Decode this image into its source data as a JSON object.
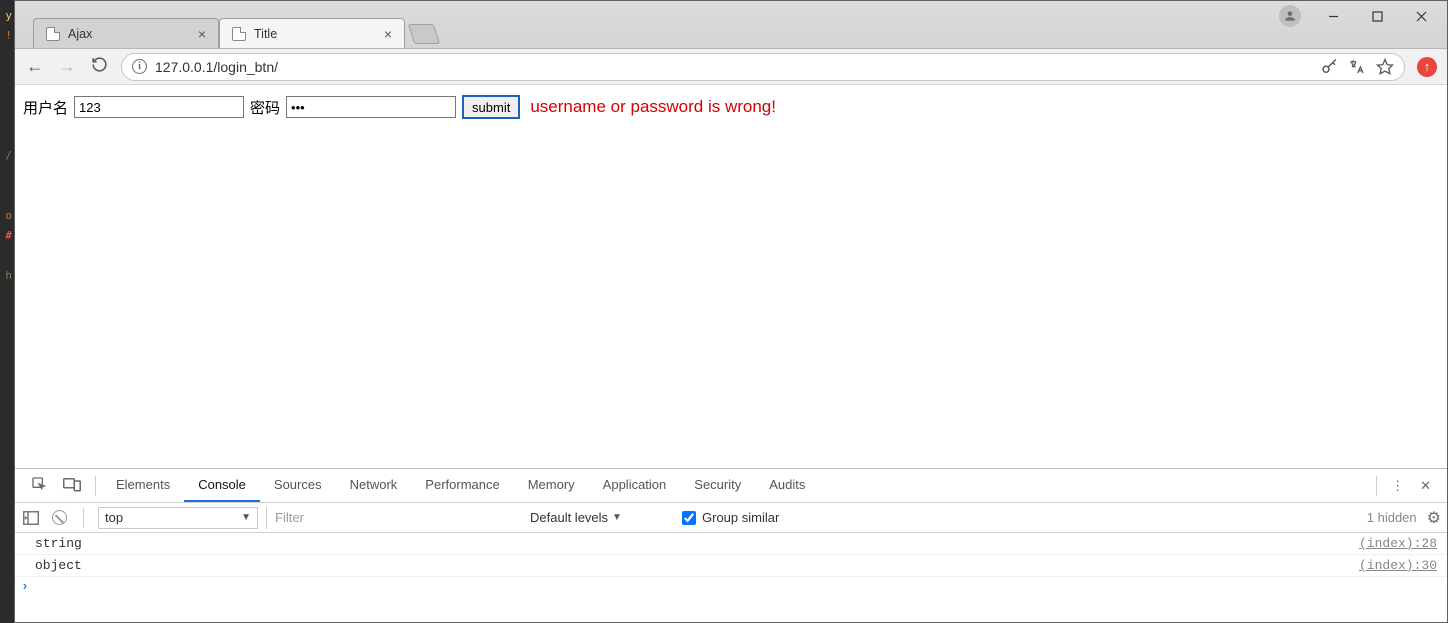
{
  "editor_gutter": [
    "y",
    "!",
    "",
    "",
    "",
    "",
    "",
    "/",
    "",
    "",
    "o",
    "#",
    "",
    "h"
  ],
  "editor_gutter_colors": [
    "g-y",
    "g-o",
    "",
    "",
    "",
    "",
    "",
    "g-s",
    "",
    "",
    "g-o",
    "g-r",
    "",
    "g-s"
  ],
  "window": {
    "tabs": [
      {
        "title": "Ajax",
        "active": false
      },
      {
        "title": "Title",
        "active": true
      }
    ]
  },
  "addrbar": {
    "url": "127.0.0.1/login_btn/"
  },
  "page": {
    "username_label": "用户名",
    "username_value": "123",
    "password_label": "密码",
    "password_value": "•••",
    "submit_label": "submit",
    "error_message": "username or password is wrong!"
  },
  "devtools": {
    "tabs": [
      "Elements",
      "Console",
      "Sources",
      "Network",
      "Performance",
      "Memory",
      "Application",
      "Security",
      "Audits"
    ],
    "tabs_active_index": 1,
    "context_dropdown": "top",
    "filter_placeholder": "Filter",
    "levels_dropdown": "Default levels",
    "group_label": "Group similar",
    "group_checked": true,
    "hidden_label": "1 hidden",
    "logs": [
      {
        "msg": "string",
        "src": "(index):28"
      },
      {
        "msg": "object",
        "src": "(index):30"
      }
    ]
  }
}
